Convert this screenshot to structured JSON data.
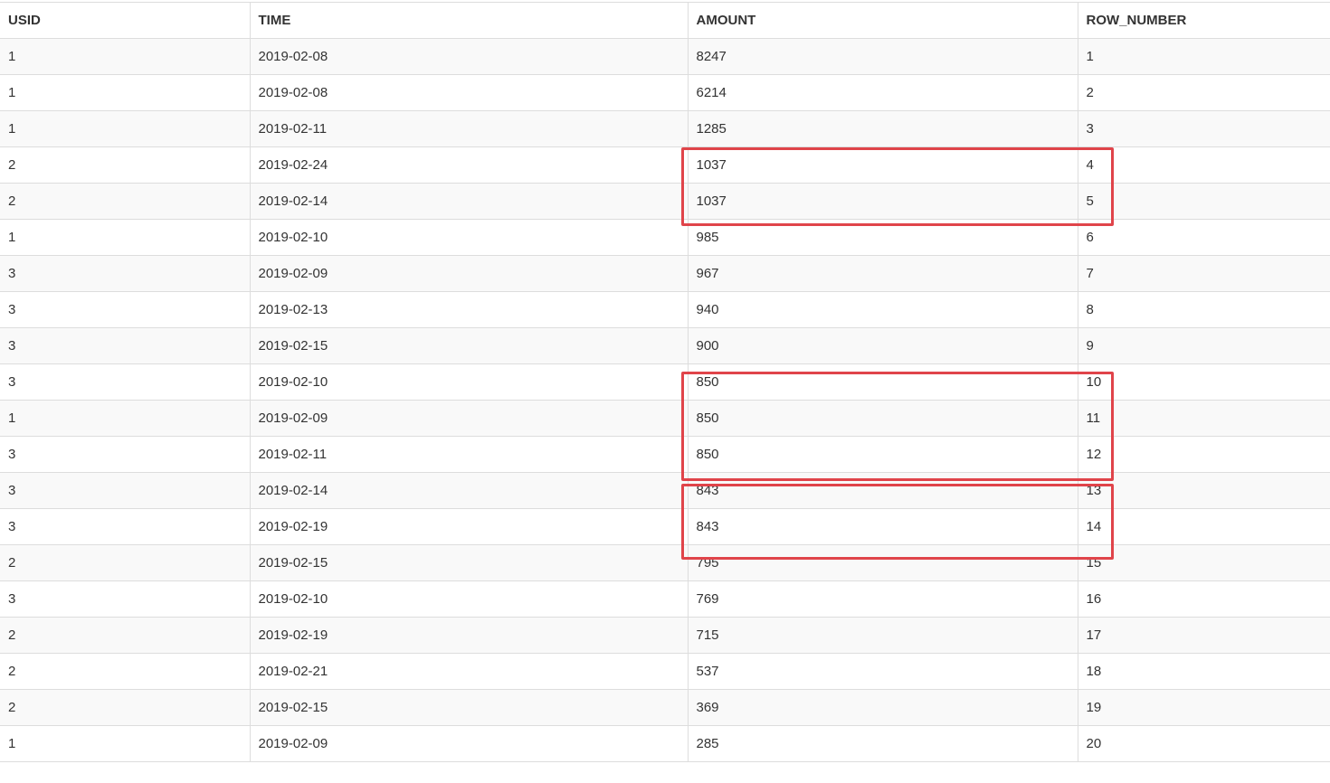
{
  "table": {
    "columns": [
      "USID",
      "TIME",
      "AMOUNT",
      "ROW_NUMBER"
    ],
    "rows": [
      [
        "1",
        "2019-02-08",
        "8247",
        "1"
      ],
      [
        "1",
        "2019-02-08",
        "6214",
        "2"
      ],
      [
        "1",
        "2019-02-11",
        "1285",
        "3"
      ],
      [
        "2",
        "2019-02-24",
        "1037",
        "4"
      ],
      [
        "2",
        "2019-02-14",
        "1037",
        "5"
      ],
      [
        "1",
        "2019-02-10",
        "985",
        "6"
      ],
      [
        "3",
        "2019-02-09",
        "967",
        "7"
      ],
      [
        "3",
        "2019-02-13",
        "940",
        "8"
      ],
      [
        "3",
        "2019-02-15",
        "900",
        "9"
      ],
      [
        "3",
        "2019-02-10",
        "850",
        "10"
      ],
      [
        "1",
        "2019-02-09",
        "850",
        "11"
      ],
      [
        "3",
        "2019-02-11",
        "850",
        "12"
      ],
      [
        "3",
        "2019-02-14",
        "843",
        "13"
      ],
      [
        "3",
        "2019-02-19",
        "843",
        "14"
      ],
      [
        "2",
        "2019-02-15",
        "795",
        "15"
      ],
      [
        "3",
        "2019-02-10",
        "769",
        "16"
      ],
      [
        "2",
        "2019-02-19",
        "715",
        "17"
      ],
      [
        "2",
        "2019-02-21",
        "537",
        "18"
      ],
      [
        "2",
        "2019-02-15",
        "369",
        "19"
      ],
      [
        "1",
        "2019-02-09",
        "285",
        "20"
      ]
    ]
  },
  "highlights": [
    {
      "columns": [
        "AMOUNT",
        "ROW_NUMBER"
      ],
      "rows": [
        "4",
        "5"
      ]
    },
    {
      "columns": [
        "AMOUNT",
        "ROW_NUMBER"
      ],
      "rows": [
        "10",
        "11",
        "12"
      ]
    },
    {
      "columns": [
        "AMOUNT",
        "ROW_NUMBER"
      ],
      "rows": [
        "13",
        "14"
      ]
    }
  ],
  "colors": {
    "highlight_border": "#e0444a",
    "grid_line": "#dddddd",
    "stripe": "#f9f9f9",
    "text": "#333333"
  }
}
